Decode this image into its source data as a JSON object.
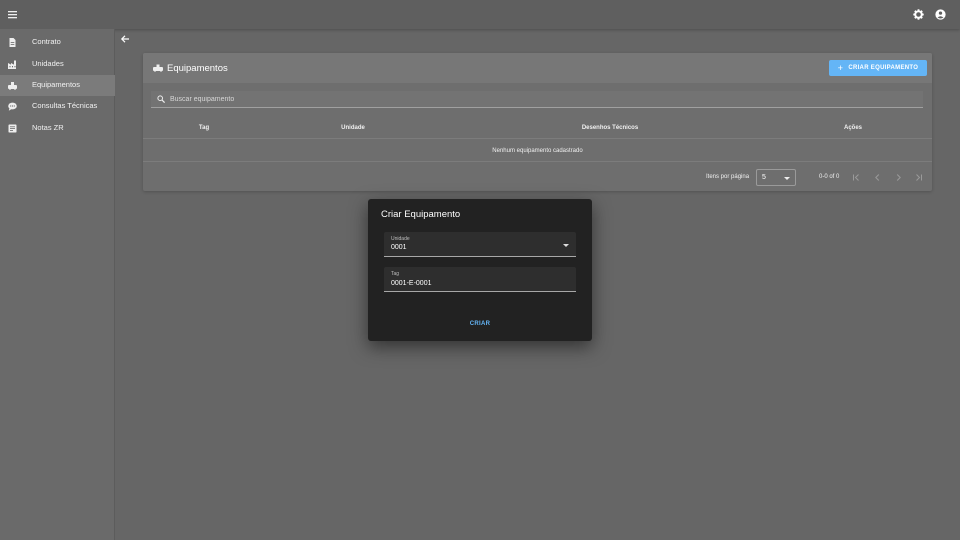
{
  "topbar": {
    "menu_icon": "menu-icon",
    "settings_icon": "gear-icon",
    "account_icon": "account-circle-icon"
  },
  "sidebar": {
    "items": [
      {
        "label": "Contrato",
        "icon": "document-icon",
        "active": false
      },
      {
        "label": "Unidades",
        "icon": "factory-icon",
        "active": false
      },
      {
        "label": "Equipamentos",
        "icon": "equipment-icon",
        "active": true
      },
      {
        "label": "Consultas Técnicas",
        "icon": "chat-bubble-icon",
        "active": false
      },
      {
        "label": "Notas ZR",
        "icon": "notes-icon",
        "active": false
      }
    ]
  },
  "page": {
    "back_icon": "arrow-left-icon",
    "title": "Equipamentos",
    "title_icon": "equipment-icon",
    "create_button": "CRIAR EQUIPAMENTO",
    "search_placeholder": "Buscar equipamento",
    "columns": [
      "Tag",
      "Unidade",
      "Desenhos Técnicos",
      "Ações"
    ],
    "empty_message": "Nenhum equipamento cadastrado",
    "pagination": {
      "items_per_page_label": "Itens por página",
      "items_per_page_value": "5",
      "range": "0-0 of 0"
    }
  },
  "dialog": {
    "title": "Criar Equipamento",
    "unit_label": "Unidade",
    "unit_value": "0001",
    "tag_label": "Tag",
    "tag_value": "0001-E-0001",
    "submit_label": "CRIAR"
  },
  "colors": {
    "accent": "#64b5f6",
    "dialog_bg": "#222222",
    "page_bg": "#666666"
  }
}
